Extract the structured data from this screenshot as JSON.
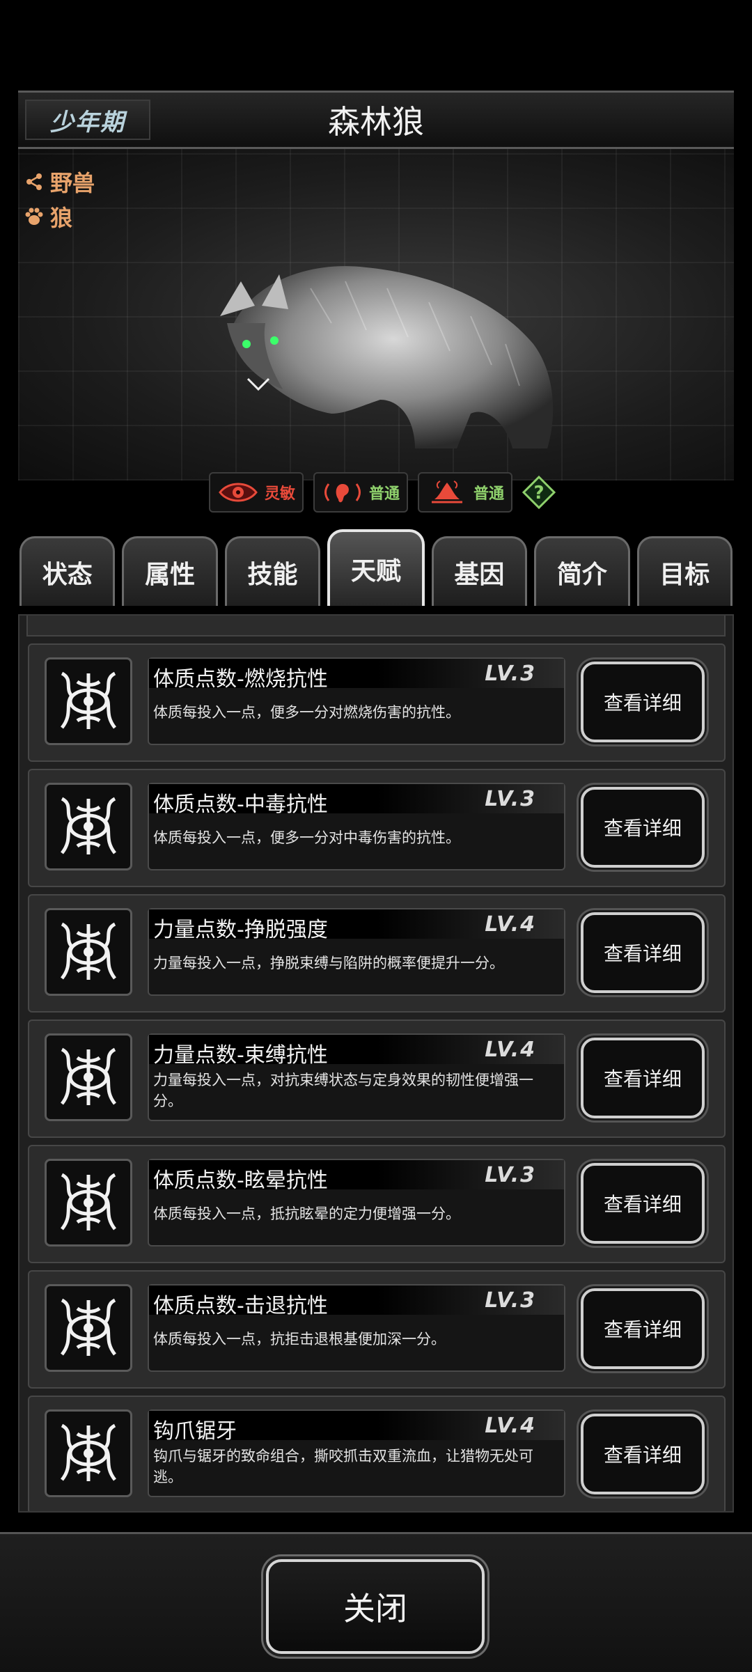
{
  "header": {
    "stage": "少年期",
    "name": "森林狼"
  },
  "tags": [
    {
      "icon": "share-node-icon",
      "label": "野兽"
    },
    {
      "icon": "paw-icon",
      "label": "狼"
    }
  ],
  "senses": [
    {
      "icon": "eye-icon",
      "label": "灵敏",
      "color": "#e84a3a"
    },
    {
      "icon": "ear-icon",
      "label": "普通",
      "color": "#8fd16c"
    },
    {
      "icon": "smell-icon",
      "label": "普通",
      "color": "#8fd16c"
    }
  ],
  "help_label": "?",
  "tabs": [
    "状态",
    "属性",
    "技能",
    "天赋",
    "基因",
    "简介",
    "目标"
  ],
  "active_tab": "天赋",
  "talents": [
    {
      "name": "体质点数-燃烧抗性",
      "level": "LV.3",
      "desc": "体质每投入一点，便多一分对燃烧伤害的抗性。",
      "button": "查看详细"
    },
    {
      "name": "体质点数-中毒抗性",
      "level": "LV.3",
      "desc": "体质每投入一点，便多一分对中毒伤害的抗性。",
      "button": "查看详细"
    },
    {
      "name": "力量点数-挣脱强度",
      "level": "LV.4",
      "desc": "力量每投入一点，挣脱束缚与陷阱的概率便提升一分。",
      "button": "查看详细"
    },
    {
      "name": "力量点数-束缚抗性",
      "level": "LV.4",
      "desc": "力量每投入一点，对抗束缚状态与定身效果的韧性便增强一分。",
      "button": "查看详细"
    },
    {
      "name": "体质点数-眩晕抗性",
      "level": "LV.3",
      "desc": "体质每投入一点，抵抗眩晕的定力便增强一分。",
      "button": "查看详细"
    },
    {
      "name": "体质点数-击退抗性",
      "level": "LV.3",
      "desc": "体质每投入一点，抗拒击退根基便加深一分。",
      "button": "查看详细"
    },
    {
      "name": "钩爪锯牙",
      "level": "LV.4",
      "desc": "钩爪与锯牙的致命组合，撕咬抓击双重流血，让猎物无处可逃。",
      "button": "查看详细"
    }
  ],
  "close_label": "关闭"
}
